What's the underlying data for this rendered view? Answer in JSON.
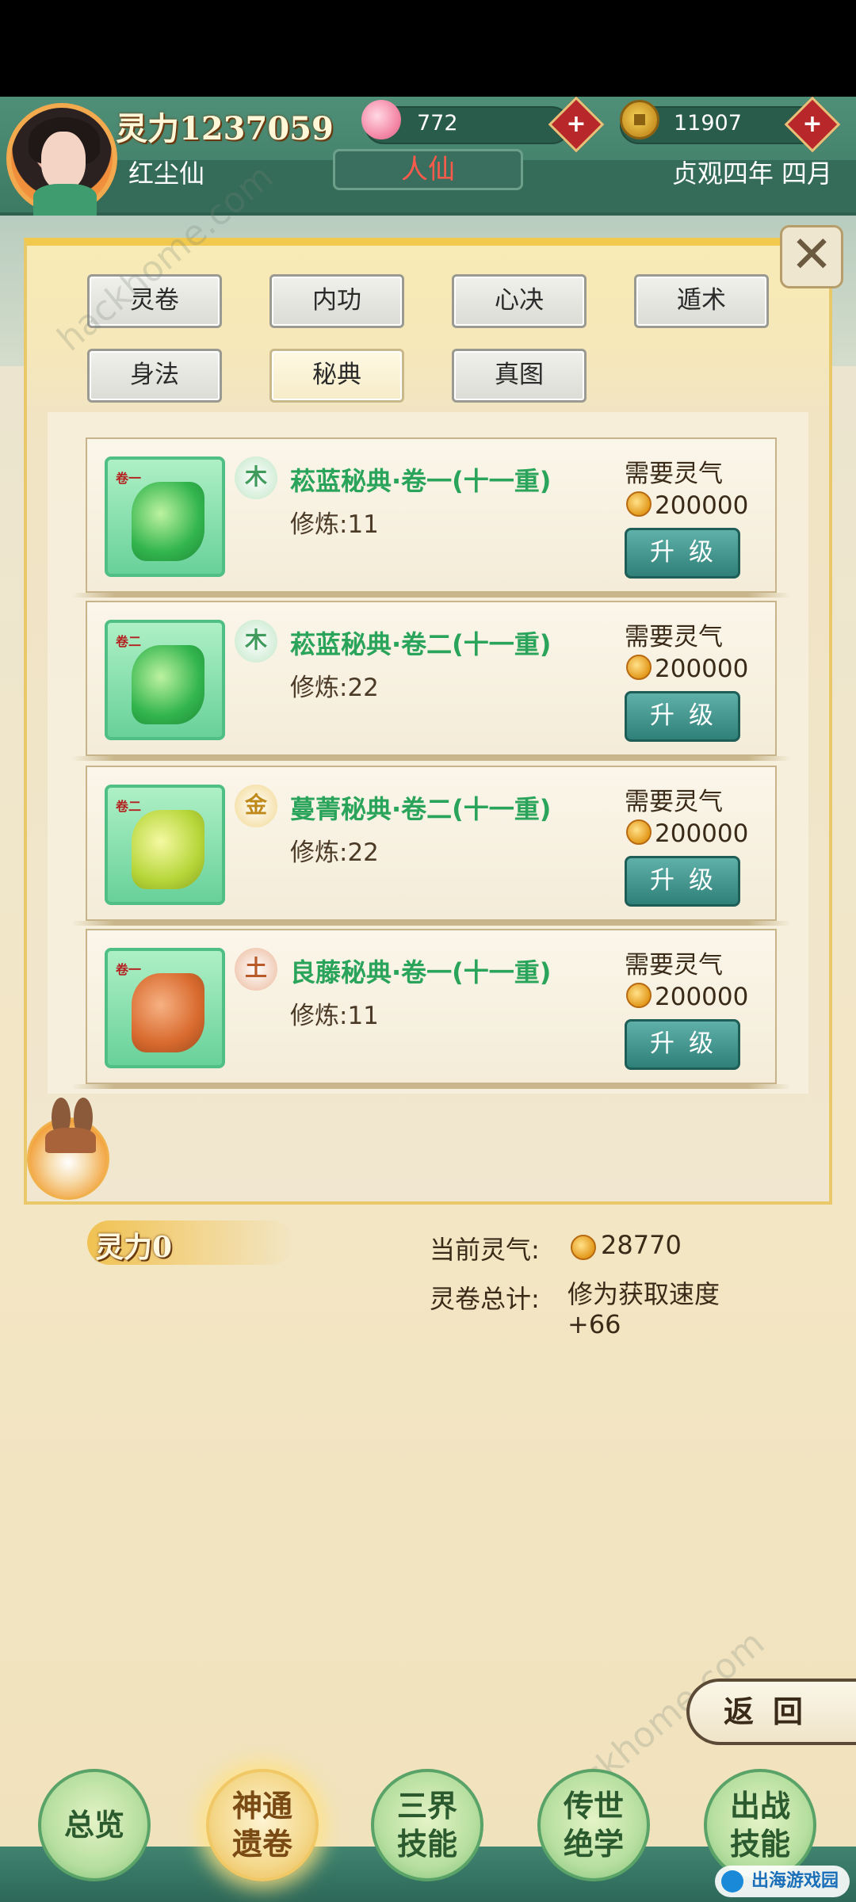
{
  "header": {
    "power_label": "灵力1237059",
    "peach_count": "772",
    "coin_count": "11907",
    "plus_symbol": "+",
    "user_name": "红尘仙",
    "realm": "人仙",
    "date": "贞观四年 四月"
  },
  "close_symbol": "✕",
  "tabs": [
    {
      "label": "灵卷"
    },
    {
      "label": "内功"
    },
    {
      "label": "心决"
    },
    {
      "label": "遁术"
    },
    {
      "label": "身法"
    },
    {
      "label": "秘典",
      "active": true
    },
    {
      "label": "真图"
    }
  ],
  "cards": [
    {
      "tag": "卷一",
      "element": "木",
      "title": "菘蓝秘典·卷一(十一重)",
      "train": "修炼:11",
      "need_label": "需要灵气",
      "need_value": "200000",
      "button": "升级"
    },
    {
      "tag": "卷二",
      "element": "木",
      "title": "菘蓝秘典·卷二(十一重)",
      "train": "修炼:22",
      "need_label": "需要灵气",
      "need_value": "200000",
      "button": "升级"
    },
    {
      "tag": "卷二",
      "element": "金",
      "title": "蔓菁秘典·卷二(十一重)",
      "train": "修炼:22",
      "need_label": "需要灵气",
      "need_value": "200000",
      "button": "升级"
    },
    {
      "tag": "卷一",
      "element": "土",
      "title": "良藤秘典·卷一(十一重)",
      "train": "修炼:11",
      "need_label": "需要灵气",
      "need_value": "200000",
      "button": "升级"
    }
  ],
  "footer": {
    "power_label": "灵力0",
    "current_label": "当前灵气:",
    "current_value": "28770",
    "total_label": "灵卷总计:",
    "total_value": "修为获取速度+66",
    "back_label": "返回"
  },
  "nav": [
    {
      "label": "总览"
    },
    {
      "label": "神通遗卷",
      "active": true
    },
    {
      "label": "三界技能"
    },
    {
      "label": "传世绝学"
    },
    {
      "label": "出战技能"
    }
  ],
  "watermark": "hackhome.com",
  "logo_text": "出海游戏园"
}
